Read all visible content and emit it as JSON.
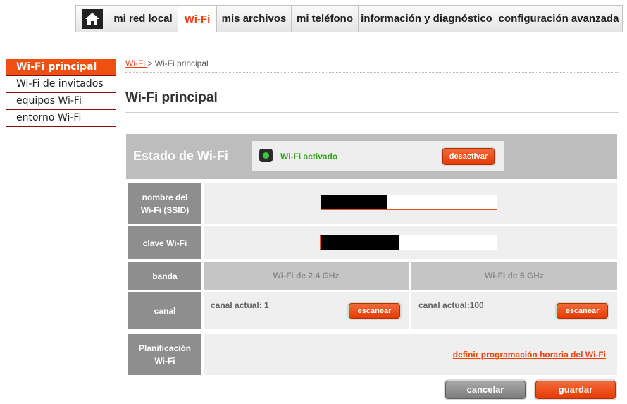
{
  "nav": {
    "home_icon": "home-icon",
    "tabs": [
      "mi red local",
      "Wi-Fi",
      "mis archivos",
      "mi teléfono",
      "información y diagnóstico",
      "configuración avanzada"
    ],
    "active_tab": "Wi-Fi"
  },
  "sidebar": {
    "items": [
      "Wi-Fi principal",
      "Wi-Fi de invitados",
      "equipos Wi-Fi",
      "entorno Wi-Fi"
    ],
    "active": "Wi-Fi principal"
  },
  "breadcrumb": {
    "link": "Wi-Fi ",
    "separator": "> ",
    "current": "Wi-Fi principal"
  },
  "page": {
    "title": "Wi-Fi principal"
  },
  "status": {
    "title": "Estado de Wi-Fi",
    "text": "Wi-Fi activado",
    "indicator_color": "#3ec83e",
    "button": "desactivar"
  },
  "ssid": {
    "label_line1": "nombre del",
    "label_line2": "Wi-Fi (SSID)",
    "value": ""
  },
  "key": {
    "label": "clave Wi-Fi",
    "value": ""
  },
  "band": {
    "label": "banda",
    "band_24": "Wi-Fi de 2.4 GHz",
    "band_5": "Wi-Fi de 5 GHz"
  },
  "channel": {
    "label": "canal",
    "current_24": "canal actual: 1",
    "current_5": "canal actual:100",
    "scan_button": "escanear"
  },
  "schedule": {
    "label_line1": "Planificación",
    "label_line2": "Wi-Fi",
    "link": "definir programación horaria del Wi-Fi"
  },
  "actions": {
    "cancel": "cancelar",
    "save": "guardar"
  },
  "colors": {
    "accent": "#f0420a",
    "label_bg": "#8e8e8e",
    "panel_bg": "#bdbdbd"
  }
}
